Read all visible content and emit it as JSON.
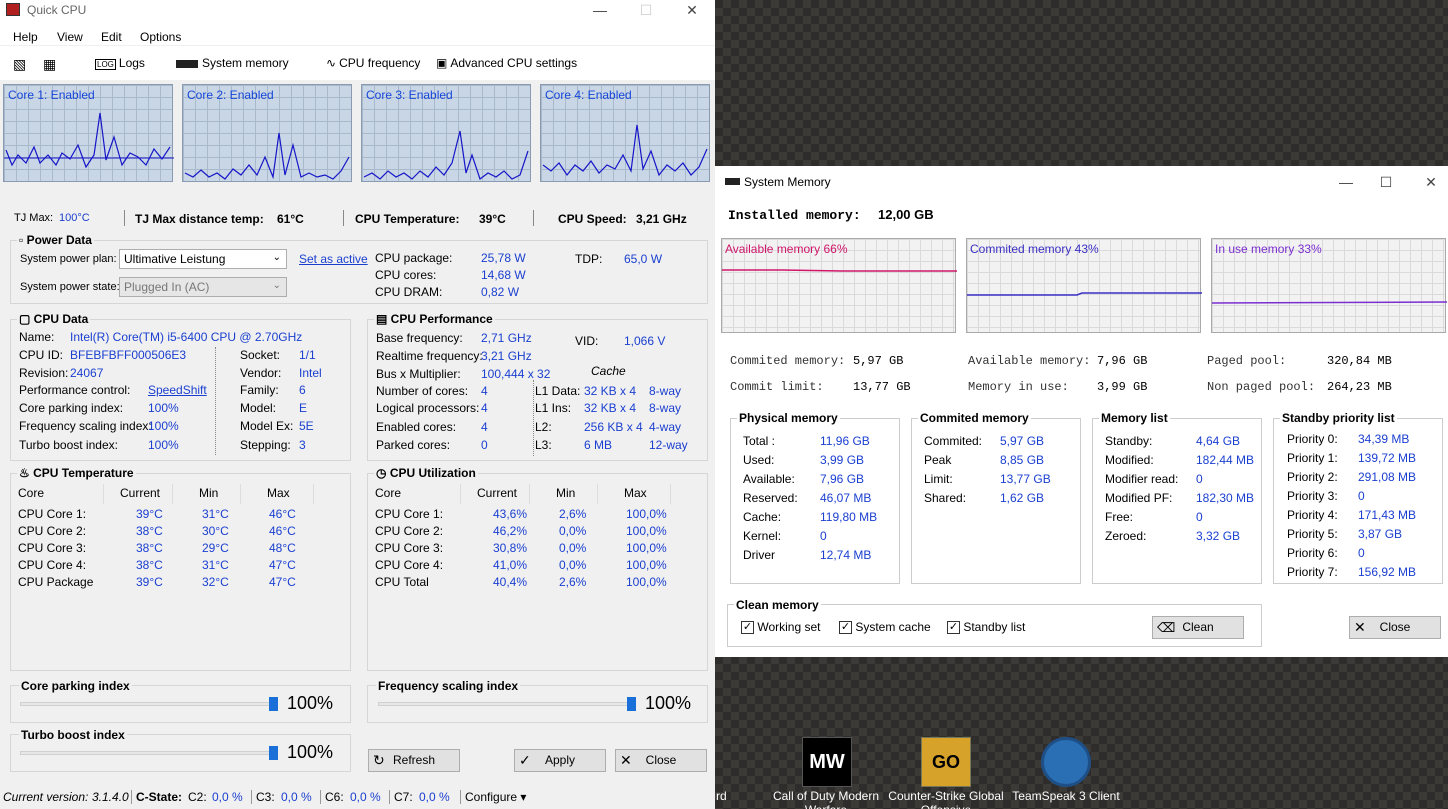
{
  "quickcpu": {
    "title": "Quick CPU",
    "menu": [
      "Help",
      "View",
      "Edit",
      "Options"
    ],
    "toolbar": {
      "logs": "Logs",
      "system_memory": "System memory",
      "cpu_frequency": "CPU frequency",
      "advanced": "Advanced CPU settings"
    },
    "cores": [
      "Core 1: Enabled",
      "Core 2: Enabled",
      "Core 3: Enabled",
      "Core 4: Enabled"
    ],
    "summary": {
      "tjmax_label": "TJ Max:",
      "tjmax_val": "100°C",
      "tjdist_label": "TJ Max distance temp:",
      "tjdist_val": "61°C",
      "temp_label": "CPU Temperature:",
      "temp_val": "39°C",
      "speed_label": "CPU Speed:",
      "speed_val": "3,21 GHz"
    },
    "power": {
      "title": "Power Data",
      "plan_label": "System power plan:",
      "plan_value": "Ultimative Leistung",
      "set_active": "Set as active",
      "state_label": "System power state:",
      "state_value": "Plugged In (AC)",
      "pkg_label": "CPU package:",
      "pkg_val": "25,78 W",
      "cores_label": "CPU cores:",
      "cores_val": "14,68 W",
      "dram_label": "CPU DRAM:",
      "dram_val": "0,82 W",
      "tdp_label": "TDP:",
      "tdp_val": "65,0 W"
    },
    "cpudata": {
      "title": "CPU Data",
      "name_label": "Name:",
      "name_val": "Intel(R) Core(TM) i5-6400 CPU @ 2.70GHz",
      "left": [
        [
          "CPU ID:",
          "BFEBFBFF000506E3"
        ],
        [
          "Revision:",
          "24067"
        ],
        [
          "Performance control:",
          "SpeedShift"
        ],
        [
          "Core parking index:",
          "100%"
        ],
        [
          "Frequency scaling index:",
          "100%"
        ],
        [
          "Turbo boost index:",
          "100%"
        ]
      ],
      "right": [
        [
          "Socket:",
          "1/1"
        ],
        [
          "Vendor:",
          "Intel"
        ],
        [
          "Family:",
          "6"
        ],
        [
          "Model:",
          "E"
        ],
        [
          "Model Ex:",
          "5E"
        ],
        [
          "Stepping:",
          "3"
        ]
      ]
    },
    "perf": {
      "title": "CPU Performance",
      "base_label": "Base frequency:",
      "base_val": "2,71 GHz",
      "vid_label": "VID:",
      "vid_val": "1,066 V",
      "rt_label": "Realtime frequency:",
      "rt_val": "3,21 GHz",
      "bus_label": "Bus x Multiplier:",
      "bus_val": "100,444 x 32",
      "cache_hdr": "Cache",
      "rows": [
        [
          "Number of cores:",
          "4",
          "L1 Data:",
          "32 KB x 4",
          "8-way"
        ],
        [
          "Logical processors:",
          "4",
          "L1 Ins:",
          "32 KB x 4",
          "8-way"
        ],
        [
          "Enabled cores:",
          "4",
          "L2:",
          "256 KB x 4",
          "4-way"
        ],
        [
          "Parked cores:",
          "0",
          "L3:",
          "6 MB",
          "12-way"
        ]
      ]
    },
    "temp": {
      "title": "CPU Temperature",
      "headers": [
        "Core",
        "Current",
        "Min",
        "Max"
      ],
      "rows": [
        [
          "CPU Core 1:",
          "39°C",
          "31°C",
          "46°C"
        ],
        [
          "CPU Core 2:",
          "38°C",
          "30°C",
          "46°C"
        ],
        [
          "CPU Core 3:",
          "38°C",
          "29°C",
          "48°C"
        ],
        [
          "CPU Core 4:",
          "38°C",
          "31°C",
          "47°C"
        ],
        [
          "CPU Package",
          "39°C",
          "32°C",
          "47°C"
        ]
      ]
    },
    "util": {
      "title": "CPU Utilization",
      "headers": [
        "Core",
        "Current",
        "Min",
        "Max"
      ],
      "rows": [
        [
          "CPU Core 1:",
          "43,6%",
          "2,6%",
          "100,0%"
        ],
        [
          "CPU Core 2:",
          "46,2%",
          "0,0%",
          "100,0%"
        ],
        [
          "CPU Core 3:",
          "30,8%",
          "0,0%",
          "100,0%"
        ],
        [
          "CPU Core 4:",
          "41,0%",
          "0,0%",
          "100,0%"
        ],
        [
          "CPU Total",
          "40,4%",
          "2,6%",
          "100,0%"
        ]
      ]
    },
    "sliders": {
      "parking_label": "Core parking index",
      "parking_val": "100%",
      "freq_label": "Frequency scaling index",
      "freq_val": "100%",
      "turbo_label": "Turbo boost index",
      "turbo_val": "100%"
    },
    "buttons": {
      "refresh": "Refresh",
      "apply": "Apply",
      "close": "Close"
    },
    "status": {
      "version_label": "Current version:",
      "version": "3.1.4.0",
      "cstate": "C-State:",
      "c2": "C2:",
      "c2v": "0,0 %",
      "c3": "C3:",
      "c3v": "0,0 %",
      "c6": "C6:",
      "c6v": "0,0 %",
      "c7": "C7:",
      "c7v": "0,0 %",
      "configure": "Configure ▾"
    }
  },
  "sysmem": {
    "title": "System Memory",
    "installed_label": "Installed memory:",
    "installed_val": "12,00 GB",
    "graphs": [
      "Available memory 66%",
      "Commited memory 43%",
      "In use memory 33%"
    ],
    "graph_colors": [
      "#d0166a",
      "#3a2fc4",
      "#7a2ed0"
    ],
    "stats": [
      [
        "Commited memory:",
        "5,97 GB"
      ],
      [
        "Commit limit:",
        "13,77 GB"
      ],
      [
        "Available memory:",
        "7,96 GB"
      ],
      [
        "Memory in use:",
        "3,99 GB"
      ],
      [
        "Paged pool:",
        "320,84 MB"
      ],
      [
        "Non paged pool:",
        "264,23 MB"
      ]
    ],
    "physical": {
      "title": "Physical memory",
      "rows": [
        [
          "Total :",
          "11,96 GB"
        ],
        [
          "Used:",
          "3,99 GB"
        ],
        [
          "Available:",
          "7,96 GB"
        ],
        [
          "Reserved:",
          "46,07 MB"
        ],
        [
          "Cache:",
          "119,80 MB"
        ],
        [
          "Kernel:",
          "0"
        ],
        [
          "Driver",
          "12,74 MB"
        ]
      ]
    },
    "commited": {
      "title": "Commited memory",
      "rows": [
        [
          "Commited:",
          "5,97 GB"
        ],
        [
          "Peak",
          "8,85 GB"
        ],
        [
          "Limit:",
          "13,77 GB"
        ],
        [
          "Shared:",
          "1,62 GB"
        ]
      ]
    },
    "list": {
      "title": "Memory list",
      "rows": [
        [
          "Standby:",
          "4,64 GB"
        ],
        [
          "Modified:",
          "182,44 MB"
        ],
        [
          "Modifier read:",
          "0"
        ],
        [
          "Modified PF:",
          "182,30 MB"
        ],
        [
          "Free:",
          "0"
        ],
        [
          "Zeroed:",
          "3,32 GB"
        ]
      ]
    },
    "standby": {
      "title": "Standby priority list",
      "rows": [
        [
          "Priority 0:",
          "34,39 MB"
        ],
        [
          "Priority 1:",
          "139,72 MB"
        ],
        [
          "Priority 2:",
          "291,08 MB"
        ],
        [
          "Priority 3:",
          "0"
        ],
        [
          "Priority 4:",
          "171,43 MB"
        ],
        [
          "Priority 5:",
          "3,87 GB"
        ],
        [
          "Priority 6:",
          "0"
        ],
        [
          "Priority 7:",
          "156,92 MB"
        ]
      ]
    },
    "clean": {
      "title": "Clean memory",
      "working": "Working set",
      "cache": "System cache",
      "standby": "Standby list",
      "clean_btn": "Clean",
      "close_btn": "Close"
    }
  },
  "desktop": {
    "icons": [
      "Call of Duty Modern Warfare",
      "Counter-Strike Global Offensive",
      "TeamSpeak 3 Client"
    ],
    "partial": "rd"
  }
}
